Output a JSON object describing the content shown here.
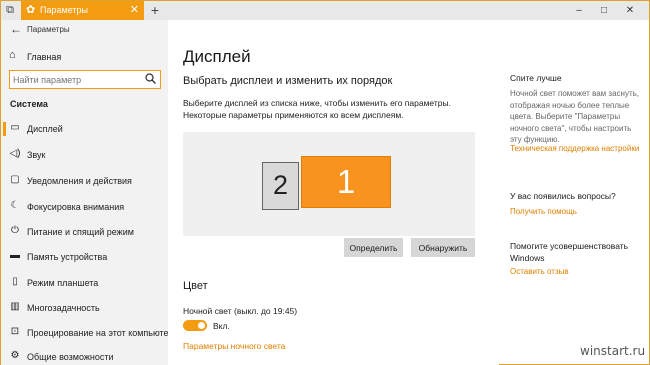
{
  "window": {
    "tab_title": "Параметры",
    "new_tab_symbol": "+",
    "close_symbol": "✕"
  },
  "sidebar": {
    "title": "Параметры",
    "home_label": "Главная",
    "search_placeholder": "Найти параметр",
    "section_label": "Система",
    "items": [
      {
        "label": "Дисплей",
        "icon": "display-icon",
        "active": true
      },
      {
        "label": "Звук",
        "icon": "speaker-icon",
        "active": false
      },
      {
        "label": "Уведомления и действия",
        "icon": "notification-icon",
        "active": false
      },
      {
        "label": "Фокусировка внимания",
        "icon": "moon-icon",
        "active": false
      },
      {
        "label": "Питание и спящий режим",
        "icon": "power-icon",
        "active": false
      },
      {
        "label": "Память устройства",
        "icon": "storage-icon",
        "active": false
      },
      {
        "label": "Режим планшета",
        "icon": "tablet-icon",
        "active": false
      },
      {
        "label": "Многозадачность",
        "icon": "multitask-icon",
        "active": false
      },
      {
        "label": "Проецирование на этот компьютер",
        "icon": "project-icon",
        "active": false
      },
      {
        "label": "Общие возможности",
        "icon": "share-icon",
        "active": false
      }
    ]
  },
  "main": {
    "title": "Дисплей",
    "subheading": "Выбрать дисплеи и изменить их порядок",
    "description": "Выберите дисплей из списка ниже, чтобы изменить его параметры. Некоторые параметры применяются ко всем дисплеям.",
    "monitors": [
      {
        "label": "2"
      },
      {
        "label": "1"
      }
    ],
    "identify_button": "Определить",
    "detect_button": "Обнаружить",
    "color_heading": "Цвет",
    "night_light_status": "Ночной свет (выкл. до 19:45)",
    "night_light_toggle_state": "Вкл.",
    "night_light_link": "Параметры ночного света"
  },
  "aside": {
    "sleep_heading": "Спите лучше",
    "sleep_text": "Ночной свет поможет вам заснуть, отображая ночью более теплые цвета. Выберите \"Параметры ночного света\", чтобы настроить эту функцию.",
    "support_link": "Техническая поддержка настройки",
    "questions_heading": "У вас появились вопросы?",
    "help_link": "Получить помощь",
    "improve_heading": "Помогите усовершенствовать Windows",
    "feedback_link": "Оставить отзыв"
  },
  "watermark": "winstart.ru",
  "colors": {
    "accent": "#f39c12",
    "link": "#e07f00",
    "sidebar_bg": "#f2f2f2",
    "selected_monitor": "#f7931e"
  }
}
